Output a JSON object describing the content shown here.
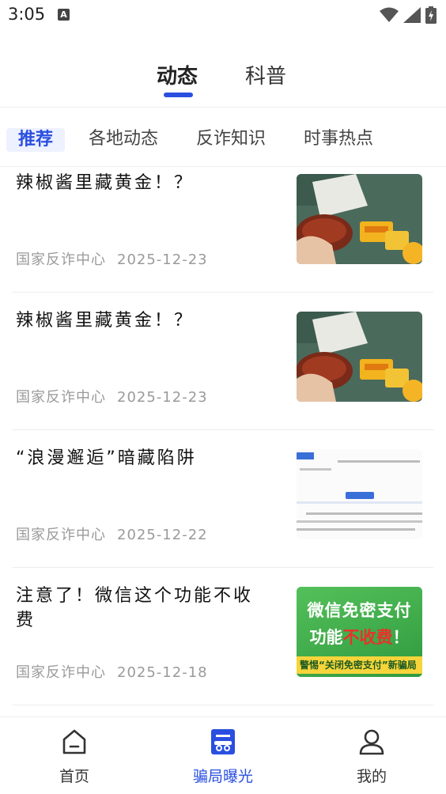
{
  "status_bar": {
    "time": "3:05",
    "notif_letter": "A"
  },
  "top_tabs": [
    {
      "label": "动态",
      "active": true
    },
    {
      "label": "科普",
      "active": false
    }
  ],
  "sub_tabs": [
    {
      "label": "推荐",
      "active": true
    },
    {
      "label": "各地动态",
      "active": false
    },
    {
      "label": "反诈知识",
      "active": false
    },
    {
      "label": "时事热点",
      "active": false
    }
  ],
  "news": [
    {
      "title": "辣椒酱里藏黄金！？",
      "source": "国家反诈中心",
      "date": "2025-12-23",
      "thumb": "chili-sauce-gold"
    },
    {
      "title": "辣椒酱里藏黄金！？",
      "source": "国家反诈中心",
      "date": "2025-12-23",
      "thumb": "chili-sauce-gold"
    },
    {
      "title": "“浪漫邂逅”暗藏陷阱",
      "source": "国家反诈中心",
      "date": "2025-12-22",
      "thumb": "document-screenshot"
    },
    {
      "title": "注意了！微信这个功能不收费",
      "source": "国家反诈中心",
      "date": "2025-12-18",
      "thumb": "wechat-pay-poster",
      "thumb_text_1": "微信免密支付",
      "thumb_text_2a": "功能",
      "thumb_text_2b": "不收费",
      "thumb_text_2c": "！",
      "thumb_text_3": "警惕“关闭免密支付”新骗局"
    }
  ],
  "bottom_nav": [
    {
      "label": "首页",
      "icon": "home-icon",
      "active": false
    },
    {
      "label": "骗局曝光",
      "icon": "scam-exposure-icon",
      "active": true
    },
    {
      "label": "我的",
      "icon": "profile-icon",
      "active": false
    }
  ],
  "colors": {
    "accent": "#2a4fe0",
    "meta_text": "#9a9a9a",
    "poster_green": "#3fb34a",
    "poster_red": "#e8322a"
  }
}
